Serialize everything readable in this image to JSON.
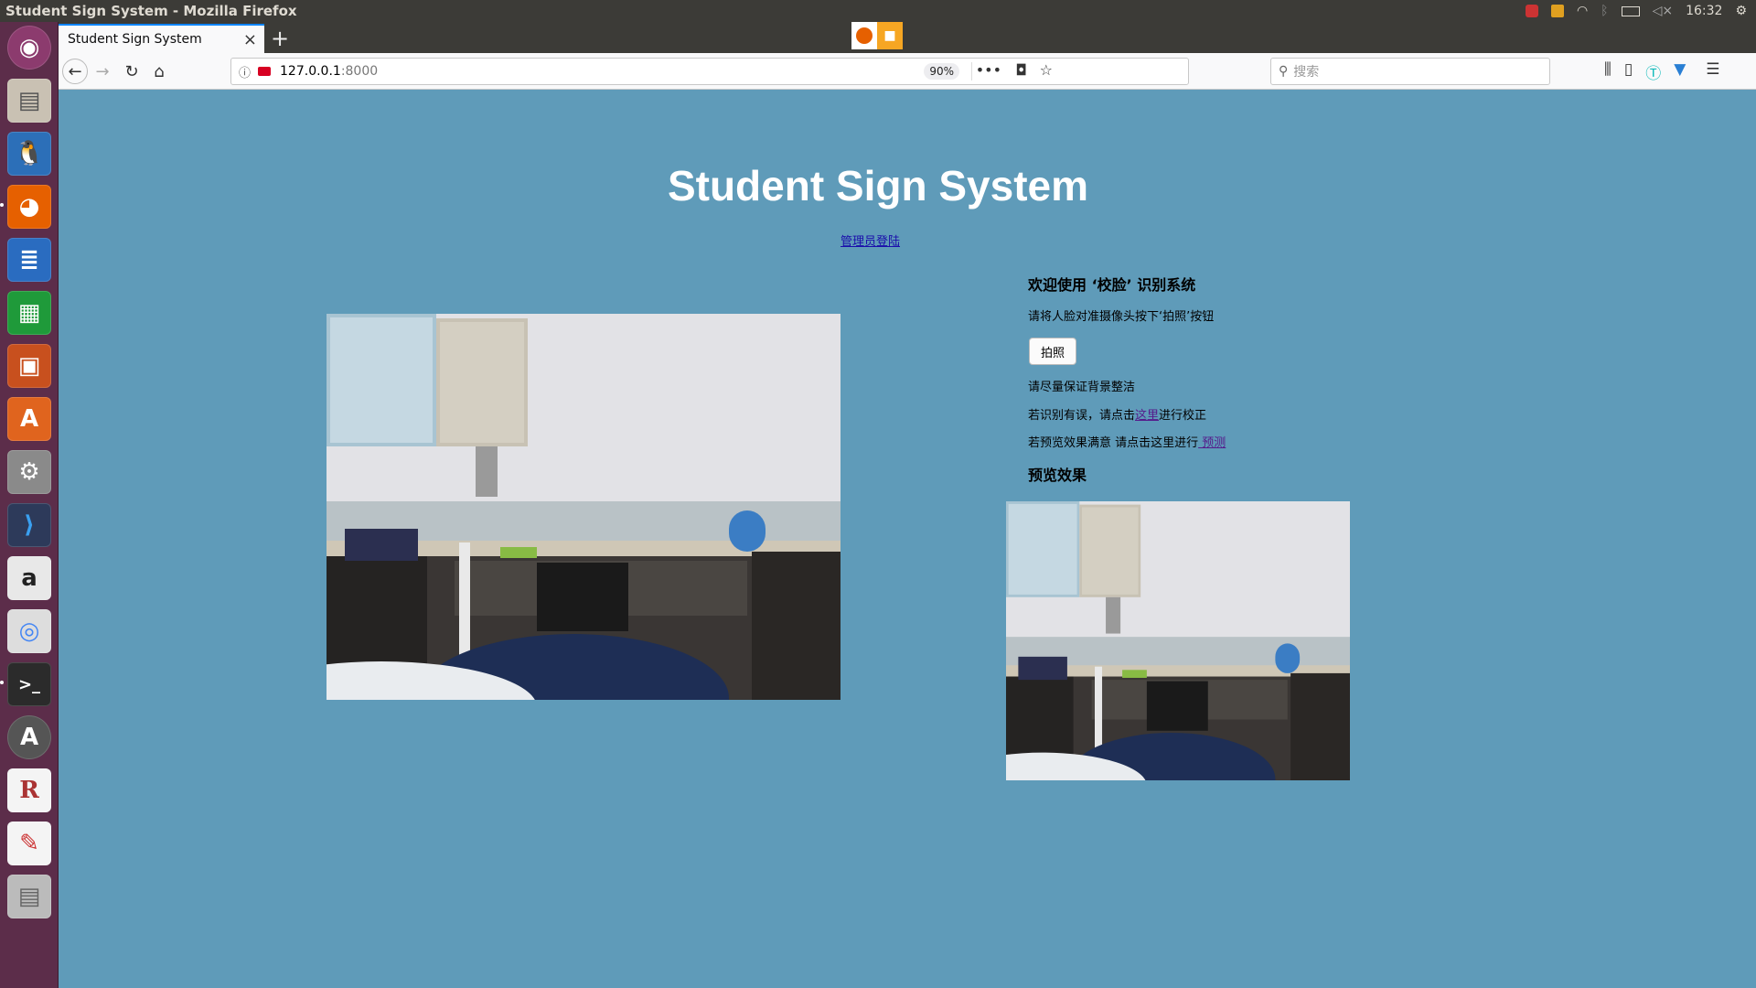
{
  "os": {
    "window_title": "Student Sign System - Mozilla Firefox",
    "clock": "16:32"
  },
  "browser": {
    "tab_title": "Student Sign System",
    "tab_close": "×",
    "new_tab": "+",
    "url_host": "127.0.0.1",
    "url_port": ":8000",
    "zoom": "90%",
    "search_placeholder": "搜索",
    "page_actions": "•••"
  },
  "page": {
    "title": "Student Sign System",
    "admin_link": "管理员登陆",
    "welcome_heading": "欢迎使用 ‘校脸’ 识别系统",
    "instruction": "请将人脸对准摄像头按下‘拍照’按钮",
    "snap_button": "拍照",
    "background_tip": "请尽量保证背景整洁",
    "correct_prefix": "若识别有误，请点击",
    "correct_link": "这里",
    "correct_suffix": "进行校正",
    "predict_prefix": "若预览效果满意  请点击这里进行",
    "predict_link": " 预测",
    "preview_heading": "预览效果"
  },
  "colors": {
    "page_background": "#5f9bb9",
    "launcher_background": "#5c2d4a",
    "topbar_background": "#3c3b37"
  },
  "launcher_icons": [
    "ubuntu-dash-icon",
    "files-icon",
    "qq-icon",
    "firefox-icon",
    "writer-icon",
    "calc-icon",
    "impress-icon",
    "software-center-icon",
    "system-settings-icon",
    "vscode-icon",
    "amazon-icon",
    "chrome-icon",
    "terminal-icon",
    "updater-icon",
    "rstudio-icon",
    "document-viewer-icon",
    "workspaces-icon"
  ]
}
